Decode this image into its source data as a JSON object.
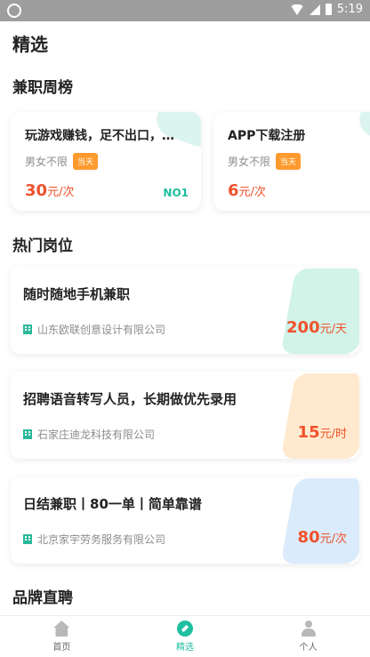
{
  "status_bar": {
    "time": "5:19"
  },
  "page": {
    "title": "精选"
  },
  "weekly": {
    "title": "兼职周榜",
    "cards": [
      {
        "title": "玩游戏赚钱，足不出口，…",
        "condition": "男女不限",
        "tag": "当天",
        "price": "30",
        "unit": "元/次",
        "rank": "NO1"
      },
      {
        "title": "APP下载注册",
        "condition": "男女不限",
        "tag": "当天",
        "price": "6",
        "unit": "元/次"
      }
    ]
  },
  "hot": {
    "title": "热门岗位",
    "jobs": [
      {
        "title": "随时随地手机兼职",
        "company": "山东欧联创意设计有限公司",
        "price": "200",
        "unit": "元/天",
        "deco_color": "#c9f1e4"
      },
      {
        "title": "招聘语音转写人员，长期做优先录用",
        "company": "石家庄迪龙科技有限公司",
        "price": "15",
        "unit": "元/时",
        "deco_color": "#ffe6c7"
      },
      {
        "title": "日结兼职丨80一单丨简单靠谱",
        "company": "北京家宇劳务服务有限公司",
        "price": "80",
        "unit": "元/次",
        "deco_color": "#d4e9fb"
      }
    ]
  },
  "brand": {
    "title": "品牌直聘"
  },
  "tabbar": {
    "items": [
      {
        "label": "首页",
        "icon": "home-icon"
      },
      {
        "label": "精选",
        "icon": "compass-icon"
      },
      {
        "label": "个人",
        "icon": "person-icon"
      }
    ],
    "active": "精选"
  },
  "colors": {
    "accent": "#1fbf9f",
    "price": "#f0522c",
    "tag": "#ff9a2e"
  }
}
